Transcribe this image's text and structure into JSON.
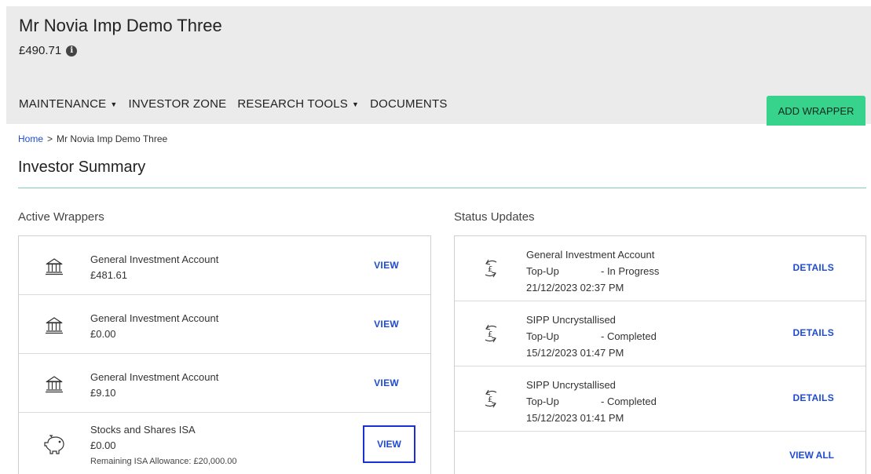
{
  "header": {
    "investor_name": "Mr Novia Imp Demo Three",
    "balance": "£490.71"
  },
  "nav": {
    "items": [
      "MAINTENANCE",
      "INVESTOR ZONE",
      "RESEARCH TOOLS",
      "DOCUMENTS"
    ],
    "add_wrapper_label": "ADD WRAPPER"
  },
  "breadcrumb": {
    "home": "Home",
    "separator": ">",
    "current": "Mr Novia Imp Demo Three"
  },
  "page_title": "Investor Summary",
  "active_wrappers": {
    "title": "Active Wrappers",
    "items": [
      {
        "name": "General Investment Account",
        "value": "£481.61",
        "action": "VIEW",
        "icon": "bank-icon"
      },
      {
        "name": "General Investment Account",
        "value": "£0.00",
        "action": "VIEW",
        "icon": "bank-icon"
      },
      {
        "name": "General Investment Account",
        "value": "£9.10",
        "action": "VIEW",
        "icon": "bank-icon"
      },
      {
        "name": "Stocks and Shares ISA",
        "value": "£0.00",
        "extra": "Remaining ISA Allowance: £20,000.00",
        "action": "VIEW",
        "icon": "piggy-bank-icon"
      }
    ]
  },
  "status_updates": {
    "title": "Status Updates",
    "items": [
      {
        "wrapper": "General Investment Account",
        "type": "Top-Up",
        "status": "- In Progress",
        "timestamp": "21/12/2023 02:37 PM",
        "action": "DETAILS",
        "icon": "pound-cycle-icon"
      },
      {
        "wrapper": "SIPP Uncrystallised",
        "type": "Top-Up",
        "status": "- Completed",
        "timestamp": "15/12/2023 01:47 PM",
        "action": "DETAILS",
        "icon": "pound-cycle-icon"
      },
      {
        "wrapper": "SIPP Uncrystallised",
        "type": "Top-Up",
        "status": "- Completed",
        "timestamp": "15/12/2023 01:41 PM",
        "action": "DETAILS",
        "icon": "pound-cycle-icon"
      }
    ],
    "view_all": "VIEW ALL"
  },
  "colors": {
    "accent_green": "#37d28c",
    "link_blue": "#1f4ad1",
    "highlight_blue": "#1a2fd6",
    "header_bg": "#ebebeb"
  }
}
